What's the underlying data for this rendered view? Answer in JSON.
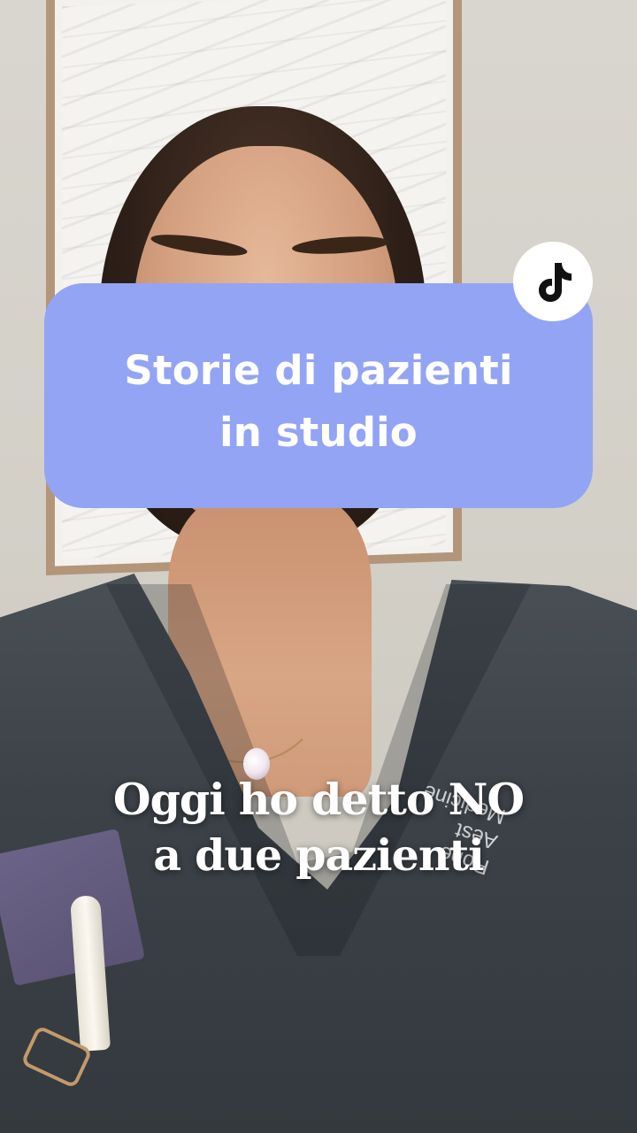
{
  "badge": {
    "line1": "Storie di pazienti",
    "line2": "in studio",
    "color": "#93a4f4"
  },
  "caption": {
    "line1": "Oggi ho detto NO",
    "line2": "a due pazienti"
  },
  "embroidery": {
    "line1": "Robe",
    "line2": "Aest",
    "line3": "Medicine"
  },
  "logo": {
    "icon": "tiktok-icon"
  }
}
